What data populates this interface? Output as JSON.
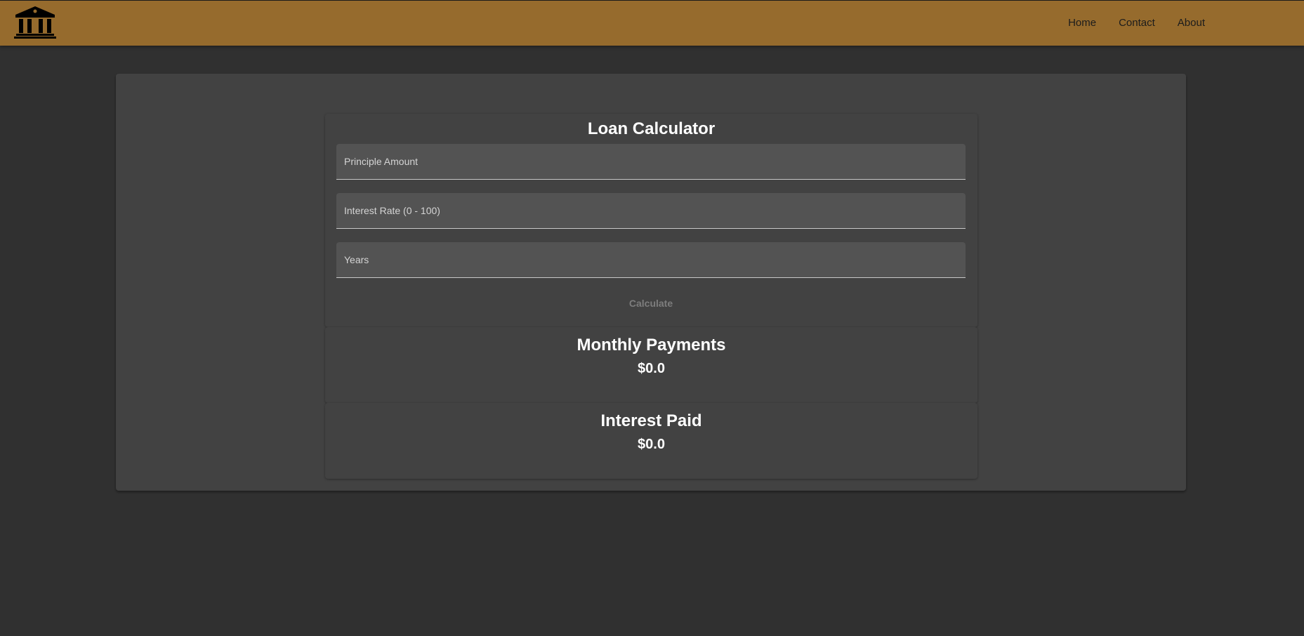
{
  "nav": {
    "logo_icon": "bank-building-icon",
    "items": [
      {
        "label": "Home"
      },
      {
        "label": "Contact"
      },
      {
        "label": "About"
      }
    ]
  },
  "calculator": {
    "title": "Loan Calculator",
    "fields": {
      "principal": {
        "placeholder": "Principle Amount",
        "value": ""
      },
      "interest_rate": {
        "placeholder": "Interest Rate (0 - 100)",
        "value": ""
      },
      "years": {
        "placeholder": "Years",
        "value": ""
      }
    },
    "calculate_label": "Calculate"
  },
  "results": {
    "monthly": {
      "label": "Monthly Payments",
      "value": "$0.0"
    },
    "interest": {
      "label": "Interest Paid",
      "value": "$0.0"
    }
  },
  "colors": {
    "topbar": "#966b2d",
    "background": "#303030",
    "card": "#424242",
    "field": "#535353"
  }
}
